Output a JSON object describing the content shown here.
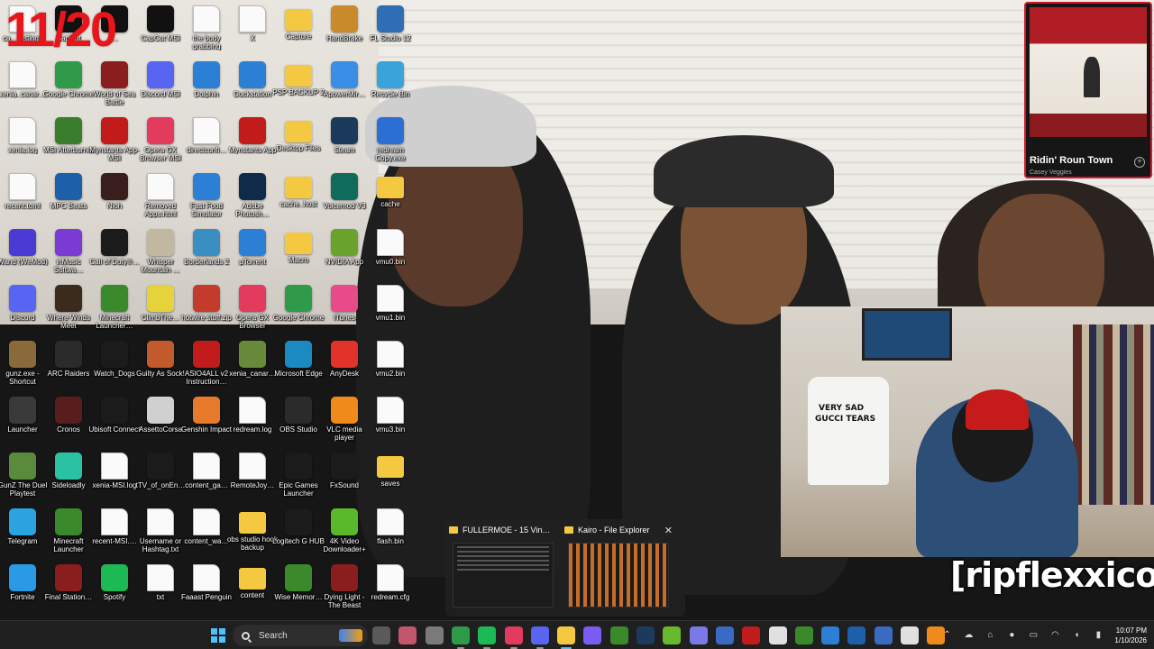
{
  "overlay": {
    "counter": "11/20",
    "watermark": "[ripflexxico]"
  },
  "desktop_icons": [
    {
      "label": "ca…settings",
      "kind": "file",
      "color": "#e0e0e0",
      "col": 0,
      "row": 0
    },
    {
      "label": "CapCut",
      "kind": "app",
      "color": "#111111",
      "col": 1,
      "row": 0
    },
    {
      "label": "…",
      "kind": "app",
      "color": "#111111",
      "col": 2,
      "row": 0
    },
    {
      "label": "CapCut MSI",
      "kind": "app",
      "color": "#111111",
      "col": 3,
      "row": 0
    },
    {
      "label": "the body grabbing",
      "kind": "file",
      "color": "#e0e0e0",
      "col": 4,
      "row": 0
    },
    {
      "label": "X",
      "kind": "file",
      "color": "#e0e0e0",
      "col": 5,
      "row": 0
    },
    {
      "label": "Capture",
      "kind": "folder",
      "color": "#f5c842",
      "col": 6,
      "row": 0
    },
    {
      "label": "HandBrake",
      "kind": "app",
      "color": "#c98a2b",
      "col": 7,
      "row": 0
    },
    {
      "label": "FL Studio 12",
      "kind": "app",
      "color": "#2f6db5",
      "col": 8,
      "row": 0
    },
    {
      "label": "xenia_canar…",
      "kind": "file",
      "color": "#e0e0e0",
      "col": 0,
      "row": 1
    },
    {
      "label": "Google Chrome",
      "kind": "app",
      "color": "#2f9a4a",
      "col": 1,
      "row": 1
    },
    {
      "label": "World of Sea Battle",
      "kind": "app",
      "color": "#8a1d1d",
      "col": 2,
      "row": 1
    },
    {
      "label": "Discord MSI",
      "kind": "app",
      "color": "#5865f2",
      "col": 3,
      "row": 1
    },
    {
      "label": "Dolphin",
      "kind": "app",
      "color": "#2b7fd4",
      "col": 4,
      "row": 1
    },
    {
      "label": "Duckstation",
      "kind": "app",
      "color": "#2b7fd4",
      "col": 5,
      "row": 1
    },
    {
      "label": "PSP BACKUP 2",
      "kind": "folder",
      "color": "#f5c842",
      "col": 6,
      "row": 1
    },
    {
      "label": "ApowerMir…",
      "kind": "app",
      "color": "#3a8ee6",
      "col": 7,
      "row": 1
    },
    {
      "label": "Recycle Bin",
      "kind": "app",
      "color": "#3aa3d9",
      "col": 8,
      "row": 1
    },
    {
      "label": "xenia.log",
      "kind": "file",
      "color": "#e0e0e0",
      "col": 0,
      "row": 2
    },
    {
      "label": "MSI Afterburner",
      "kind": "app",
      "color": "#3a7d2c",
      "col": 1,
      "row": 2
    },
    {
      "label": "Mynstants App-MSI",
      "kind": "app",
      "color": "#c21b1b",
      "col": 2,
      "row": 2
    },
    {
      "label": "Opera GX Browser MSI",
      "kind": "app",
      "color": "#e23b5e",
      "col": 3,
      "row": 2
    },
    {
      "label": "directconfi…",
      "kind": "file",
      "color": "#e0e0e0",
      "col": 4,
      "row": 2
    },
    {
      "label": "Mynstants App",
      "kind": "app",
      "color": "#c21b1b",
      "col": 5,
      "row": 2
    },
    {
      "label": "Desktop Files",
      "kind": "folder",
      "color": "#f5c842",
      "col": 6,
      "row": 2
    },
    {
      "label": "Steam",
      "kind": "app",
      "color": "#1b3a5c",
      "col": 7,
      "row": 2
    },
    {
      "label": "redream Copy.exe",
      "kind": "app",
      "color": "#2b6fd4",
      "col": 8,
      "row": 2
    },
    {
      "label": "recent.toml",
      "kind": "file",
      "color": "#e0e0e0",
      "col": 0,
      "row": 3
    },
    {
      "label": "MPC Beats",
      "kind": "app",
      "color": "#1d5fa8",
      "col": 1,
      "row": 3
    },
    {
      "label": "Nioh",
      "kind": "app",
      "color": "#3a1d1d",
      "col": 2,
      "row": 3
    },
    {
      "label": "Removed Apps.html",
      "kind": "file",
      "color": "#e0e0e0",
      "col": 3,
      "row": 3
    },
    {
      "label": "Fast Food Simulator",
      "kind": "app",
      "color": "#2b7fd4",
      "col": 4,
      "row": 3
    },
    {
      "label": "Adobe Photosh…",
      "kind": "app",
      "color": "#0f2b4a",
      "col": 5,
      "row": 3
    },
    {
      "label": "cache_host",
      "kind": "folder",
      "color": "#f5c842",
      "col": 6,
      "row": 3
    },
    {
      "label": "Voicemod V3",
      "kind": "app",
      "color": "#0f6b5c",
      "col": 7,
      "row": 3
    },
    {
      "label": "cache",
      "kind": "folder",
      "color": "#f5c842",
      "col": 8,
      "row": 3
    },
    {
      "label": "Wand (WeMod)",
      "kind": "app",
      "color": "#4b3bd4",
      "col": 0,
      "row": 4
    },
    {
      "label": "inMusic Softwa…",
      "kind": "app",
      "color": "#7a3bd4",
      "col": 1,
      "row": 4
    },
    {
      "label": "Call of Duty®…",
      "kind": "app",
      "color": "#1b1b1b",
      "col": 2,
      "row": 4
    },
    {
      "label": "Whisper Mountain …",
      "kind": "app",
      "color": "#c2b8a0",
      "col": 3,
      "row": 4
    },
    {
      "label": "Borderlands 2",
      "kind": "app",
      "color": "#3a8ec2",
      "col": 4,
      "row": 4
    },
    {
      "label": "µTorrent",
      "kind": "app",
      "color": "#2b7fd4",
      "col": 5,
      "row": 4
    },
    {
      "label": "Macro",
      "kind": "folder",
      "color": "#f5c842",
      "col": 6,
      "row": 4
    },
    {
      "label": "NVIDIA App",
      "kind": "app",
      "color": "#6aa32b",
      "col": 7,
      "row": 4
    },
    {
      "label": "vmu0.bin",
      "kind": "file",
      "color": "#e0e0e0",
      "col": 8,
      "row": 4
    },
    {
      "label": "Discord",
      "kind": "app",
      "color": "#5865f2",
      "col": 0,
      "row": 5
    },
    {
      "label": "Where Winds Meet",
      "kind": "app",
      "color": "#3a2b1d",
      "col": 1,
      "row": 5
    },
    {
      "label": "Minecraft Launcher…",
      "kind": "app",
      "color": "#3a8a2b",
      "col": 2,
      "row": 5
    },
    {
      "label": "ClimbThe…",
      "kind": "app",
      "color": "#e6d23b",
      "col": 3,
      "row": 5
    },
    {
      "label": "hotwire stuff.zip",
      "kind": "app",
      "color": "#c23b2b",
      "col": 4,
      "row": 5
    },
    {
      "label": "Opera GX Browser",
      "kind": "app",
      "color": "#e23b5e",
      "col": 5,
      "row": 5
    },
    {
      "label": "Google Chrome",
      "kind": "app",
      "color": "#2f9a4a",
      "col": 6,
      "row": 5
    },
    {
      "label": "iTunes",
      "kind": "app",
      "color": "#e84b8a",
      "col": 7,
      "row": 5
    },
    {
      "label": "vmu1.bin",
      "kind": "file",
      "color": "#e0e0e0",
      "col": 8,
      "row": 5
    },
    {
      "label": "gunz.exe - Shortcut",
      "kind": "app",
      "color": "#8a6a3b",
      "col": 0,
      "row": 6
    },
    {
      "label": "ARC Raiders",
      "kind": "app",
      "color": "#2b2b2b",
      "col": 1,
      "row": 6
    },
    {
      "label": "Watch_Dogs",
      "kind": "app",
      "color": "#1b1b1b",
      "col": 2,
      "row": 6
    },
    {
      "label": "Guilty As Sock!",
      "kind": "app",
      "color": "#c25a2b",
      "col": 3,
      "row": 6
    },
    {
      "label": "ASIO4ALL v2 Instruction…",
      "kind": "app",
      "color": "#c21b1b",
      "col": 4,
      "row": 6
    },
    {
      "label": "xenia_canar…",
      "kind": "app",
      "color": "#6a8a3b",
      "col": 5,
      "row": 6
    },
    {
      "label": "Microsoft Edge",
      "kind": "app",
      "color": "#1b8ac2",
      "col": 6,
      "row": 6
    },
    {
      "label": "AnyDesk",
      "kind": "app",
      "color": "#e2332b",
      "col": 7,
      "row": 6
    },
    {
      "label": "vmu2.bin",
      "kind": "file",
      "color": "#e0e0e0",
      "col": 8,
      "row": 6
    },
    {
      "label": "Launcher",
      "kind": "app",
      "color": "#3a3a3a",
      "col": 0,
      "row": 7
    },
    {
      "label": "Cronos",
      "kind": "app",
      "color": "#5a1d1d",
      "col": 1,
      "row": 7
    },
    {
      "label": "Ubisoft Connect",
      "kind": "app",
      "color": "#1b1b1b",
      "col": 2,
      "row": 7
    },
    {
      "label": "AssettoCorsa",
      "kind": "app",
      "color": "#d0d0d0",
      "col": 3,
      "row": 7
    },
    {
      "label": "Genshin Impact",
      "kind": "app",
      "color": "#e87b2b",
      "col": 4,
      "row": 7
    },
    {
      "label": "redream.log",
      "kind": "file",
      "color": "#e0e0e0",
      "col": 5,
      "row": 7
    },
    {
      "label": "OBS Studio",
      "kind": "app",
      "color": "#2b2b2b",
      "col": 6,
      "row": 7
    },
    {
      "label": "VLC media player",
      "kind": "app",
      "color": "#f08a1b",
      "col": 7,
      "row": 7
    },
    {
      "label": "vmu3.bin",
      "kind": "file",
      "color": "#e0e0e0",
      "col": 8,
      "row": 7
    },
    {
      "label": "GunZ The Duel Playtest",
      "kind": "app",
      "color": "#5a8a3b",
      "col": 0,
      "row": 8
    },
    {
      "label": "Sideloadly",
      "kind": "app",
      "color": "#2bc2a3",
      "col": 1,
      "row": 8
    },
    {
      "label": "xenia-MSI.log",
      "kind": "file",
      "color": "#e0e0e0",
      "col": 2,
      "row": 8
    },
    {
      "label": "tTV_of_onEn…",
      "kind": "app",
      "color": "#1b1b1b",
      "col": 3,
      "row": 8
    },
    {
      "label": "content_ga…",
      "kind": "file",
      "color": "#e0e0e0",
      "col": 4,
      "row": 8
    },
    {
      "label": "RemoteJoy…",
      "kind": "file",
      "color": "#e0e0e0",
      "col": 5,
      "row": 8
    },
    {
      "label": "Epic Games Launcher",
      "kind": "app",
      "color": "#1b1b1b",
      "col": 6,
      "row": 8
    },
    {
      "label": "FxSound",
      "kind": "app",
      "color": "#1b1b1b",
      "col": 7,
      "row": 8
    },
    {
      "label": "saves",
      "kind": "folder",
      "color": "#f5c842",
      "col": 8,
      "row": 8
    },
    {
      "label": "Telegram",
      "kind": "app",
      "color": "#2aa3e0",
      "col": 0,
      "row": 9
    },
    {
      "label": "Minecraft Launcher",
      "kind": "app",
      "color": "#3a8a2b",
      "col": 1,
      "row": 9
    },
    {
      "label": "recent-MSI.…",
      "kind": "file",
      "color": "#e0e0e0",
      "col": 2,
      "row": 9
    },
    {
      "label": "Username or Hashtag.txt",
      "kind": "file",
      "color": "#e0e0e0",
      "col": 3,
      "row": 9
    },
    {
      "label": "content_wa…",
      "kind": "file",
      "color": "#e0e0e0",
      "col": 4,
      "row": 9
    },
    {
      "label": "obs studio hook backup",
      "kind": "folder",
      "color": "#f5c842",
      "col": 5,
      "row": 9
    },
    {
      "label": "Logitech G HUB",
      "kind": "app",
      "color": "#1b1b1b",
      "col": 6,
      "row": 9
    },
    {
      "label": "4K Video Downloader+",
      "kind": "app",
      "color": "#5ab82b",
      "col": 7,
      "row": 9
    },
    {
      "label": "flash.bin",
      "kind": "file",
      "color": "#e0e0e0",
      "col": 8,
      "row": 9
    },
    {
      "label": "Fortnite",
      "kind": "app",
      "color": "#2b9ae6",
      "col": 0,
      "row": 10
    },
    {
      "label": "Final Station…",
      "kind": "app",
      "color": "#8a1d1d",
      "col": 1,
      "row": 10
    },
    {
      "label": "Spotify",
      "kind": "app",
      "color": "#1db954",
      "col": 2,
      "row": 10
    },
    {
      "label": "txt",
      "kind": "file",
      "color": "#e0e0e0",
      "col": 3,
      "row": 10
    },
    {
      "label": "Faaast Penguin",
      "kind": "file",
      "color": "#e0e0e0",
      "col": 4,
      "row": 10
    },
    {
      "label": "content",
      "kind": "folder",
      "color": "#f5c842",
      "col": 5,
      "row": 10
    },
    {
      "label": "Wise Memor…",
      "kind": "app",
      "color": "#3a8a2b",
      "col": 6,
      "row": 10
    },
    {
      "label": "Dying Light - The Beast",
      "kind": "app",
      "color": "#8a1d1d",
      "col": 7,
      "row": 10
    },
    {
      "label": "redream.cfg",
      "kind": "file",
      "color": "#e0e0e0",
      "col": 8,
      "row": 10
    }
  ],
  "now_playing": {
    "title": "Ridin' Roun Town",
    "artist": "Casey Veggies"
  },
  "webcam": {
    "shirt_line1": "VERY SAD",
    "shirt_line2": "GUCCI TEARS"
  },
  "taskbar_preview": {
    "windows": [
      {
        "title": "FULLERMOE - 15 Vin…",
        "active": false
      },
      {
        "title": "Kairo - File Explorer",
        "active": true
      }
    ],
    "close_glyph": "✕"
  },
  "taskbar": {
    "search_label": "Search",
    "apps": [
      {
        "name": "task-view-icon",
        "color": "#5a5a5a",
        "state": ""
      },
      {
        "name": "gaming-app-icon",
        "color": "#c2566b",
        "state": ""
      },
      {
        "name": "settings-icon",
        "color": "#7a7a7a",
        "state": ""
      },
      {
        "name": "chrome-icon",
        "color": "#2f9a4a",
        "state": "running"
      },
      {
        "name": "spotify-icon",
        "color": "#1db954",
        "state": "running"
      },
      {
        "name": "opera-gx-icon",
        "color": "#e23b5e",
        "state": "running"
      },
      {
        "name": "discord-icon",
        "color": "#5865f2",
        "state": "running"
      },
      {
        "name": "file-explorer-icon",
        "color": "#f5c842",
        "state": "active"
      },
      {
        "name": "discord-msi-icon",
        "color": "#7a5cf2",
        "state": ""
      },
      {
        "name": "xbox-icon",
        "color": "#3a8a2b",
        "state": ""
      },
      {
        "name": "steam-icon",
        "color": "#1b3a5c",
        "state": ""
      },
      {
        "name": "xenia-icon",
        "color": "#6ab82b",
        "state": ""
      },
      {
        "name": "gamepad-icon",
        "color": "#7a7ae6",
        "state": ""
      },
      {
        "name": "vpn-icon",
        "color": "#3a6ac2",
        "state": ""
      },
      {
        "name": "mynstants-icon",
        "color": "#c21b1b",
        "state": ""
      },
      {
        "name": "capcut-icon",
        "color": "#e0e0e0",
        "state": ""
      },
      {
        "name": "minecraft-icon",
        "color": "#3a8a2b",
        "state": ""
      },
      {
        "name": "dolphin-icon",
        "color": "#2b7fd4",
        "state": ""
      },
      {
        "name": "photoshop-icon",
        "color": "#1d5fa8",
        "state": ""
      },
      {
        "name": "calculator-icon",
        "color": "#3a6ac2",
        "state": ""
      },
      {
        "name": "capcut-msi-icon",
        "color": "#e0e0e0",
        "state": ""
      },
      {
        "name": "vlc-icon",
        "color": "#f08a1b",
        "state": ""
      }
    ],
    "clock_time": "10:07 PM",
    "clock_date": "1/10/2026"
  }
}
